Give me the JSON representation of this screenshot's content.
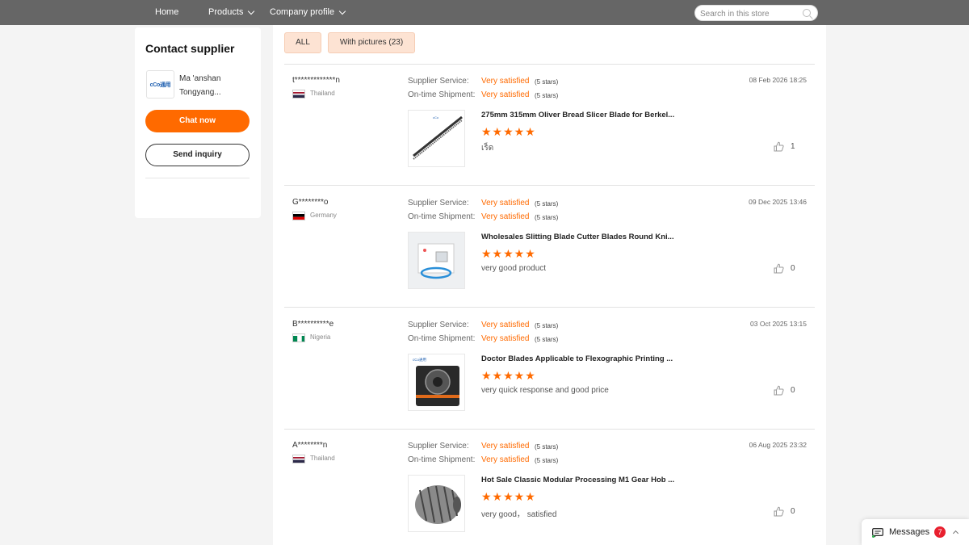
{
  "nav": {
    "home": "Home",
    "products": "Products",
    "company_profile": "Company profile",
    "search_placeholder": "Search in this store"
  },
  "contact": {
    "title": "Contact supplier",
    "logo_text": "cCo通用",
    "company_name": "Ma 'anshan Tongyang...",
    "chat_label": "Chat now",
    "inquiry_label": "Send inquiry"
  },
  "filters": {
    "all": "ALL",
    "with_pictures": "With pictures (23)"
  },
  "labels": {
    "supplier_service": "Supplier Service:",
    "on_time_shipment": "On-time Shipment:"
  },
  "reviews": [
    {
      "user": "t*************n",
      "country": "Thailand",
      "flag": "thailand",
      "supplier_service": "Very satisfied",
      "supplier_stars": "(5 stars)",
      "shipment": "Very satisfied",
      "shipment_stars": "(5 stars)",
      "date": "08 Feb 2026 18:25",
      "product_title": "275mm 315mm Oliver Bread Slicer Blade for Berkel...",
      "rating": "★★★★★",
      "comment": "เร็ด",
      "likes": "1",
      "thumb": "saw-blade"
    },
    {
      "user": "G********o",
      "country": "Germany",
      "flag": "germany",
      "supplier_service": "Very satisfied",
      "supplier_stars": "(5 stars)",
      "shipment": "Very satisfied",
      "shipment_stars": "(5 stars)",
      "date": "09 Dec 2025 13:46",
      "product_title": "Wholesales Slitting Blade Cutter Blades Round Kni...",
      "rating": "★★★★★",
      "comment": "very good product",
      "likes": "0",
      "thumb": "round-blade"
    },
    {
      "user": "B**********e",
      "country": "Nigeria",
      "flag": "nigeria",
      "supplier_service": "Very satisfied",
      "supplier_stars": "(5 stars)",
      "shipment": "Very satisfied",
      "shipment_stars": "(5 stars)",
      "date": "03 Oct 2025 13:15",
      "product_title": "Doctor Blades Applicable to Flexographic Printing ...",
      "rating": "★★★★★",
      "comment": "very quick response and good price",
      "likes": "0",
      "thumb": "doctor-blade-box"
    },
    {
      "user": "A********n",
      "country": "Thailand",
      "flag": "thailand",
      "supplier_service": "Very satisfied",
      "supplier_stars": "(5 stars)",
      "shipment": "Very satisfied",
      "shipment_stars": "(5 stars)",
      "date": "06 Aug 2025 23:32",
      "product_title": "Hot Sale Classic Modular Processing M1 Gear Hob ...",
      "rating": "★★★★★",
      "comment": "very good， satisfied",
      "likes": "0",
      "thumb": "gear-hob"
    }
  ],
  "messages": {
    "label": "Messages",
    "count": "7"
  },
  "colors": {
    "accent": "#ff6a00",
    "nav_bg": "#666666",
    "filter_bg": "#fde3d3",
    "badge": "#e8202f"
  }
}
